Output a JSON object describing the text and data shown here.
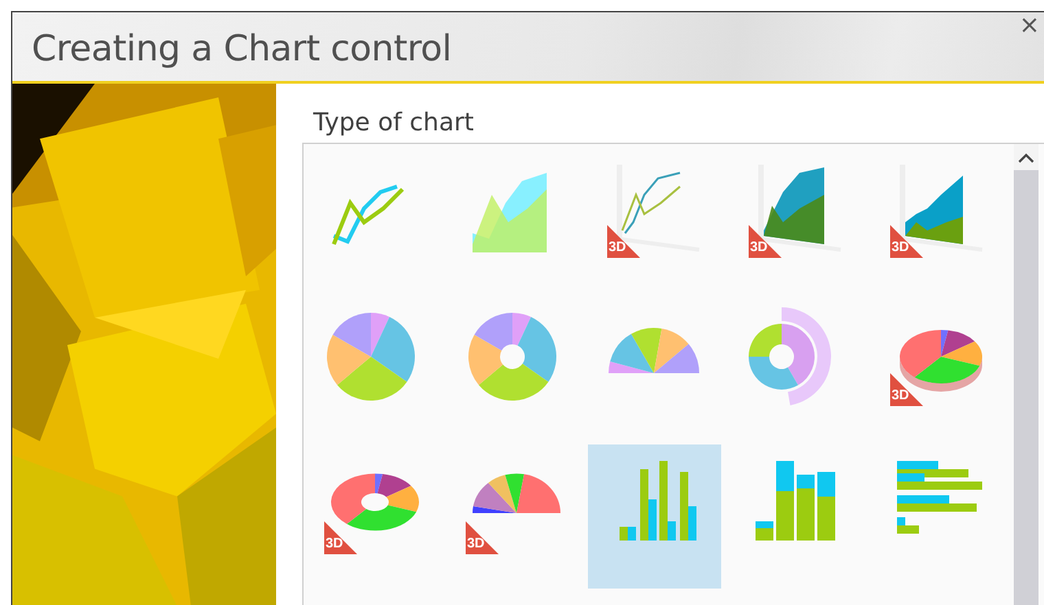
{
  "window": {
    "title": "Creating a Chart control",
    "close": "×"
  },
  "section_label": "Type of chart",
  "chart_types": [
    {
      "kind": "line",
      "selected": false
    },
    {
      "kind": "area",
      "selected": false
    },
    {
      "kind": "line3d",
      "selected": false,
      "badge": "3D"
    },
    {
      "kind": "area3d",
      "selected": false,
      "badge": "3D"
    },
    {
      "kind": "stackedarea3d",
      "selected": false,
      "badge": "3D"
    },
    {
      "kind": "pie",
      "selected": false
    },
    {
      "kind": "doughnut",
      "selected": false
    },
    {
      "kind": "halfpie",
      "selected": false
    },
    {
      "kind": "multidoughnut",
      "selected": false
    },
    {
      "kind": "pie3d",
      "selected": false,
      "badge": "3D"
    },
    {
      "kind": "doughnut3d",
      "selected": false,
      "badge": "3D"
    },
    {
      "kind": "halfpie3d",
      "selected": false,
      "badge": "3D"
    },
    {
      "kind": "column",
      "selected": true
    },
    {
      "kind": "stackedcolumn",
      "selected": false
    },
    {
      "kind": "bar",
      "selected": false
    }
  ]
}
